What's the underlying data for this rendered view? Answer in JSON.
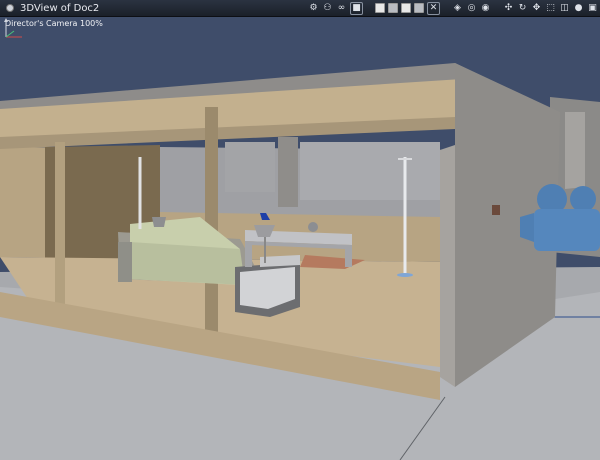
{
  "window": {
    "title": "3DView of Doc2"
  },
  "viewport": {
    "camera_label": "Director's Camera 100%"
  },
  "toolbar": {
    "icons": [
      "render-options-icon",
      "hierarchy-icon",
      "glasses-icon",
      "shading-solid-icon",
      "layout-1-icon",
      "layout-2-icon",
      "layout-3-icon",
      "layout-4-icon",
      "close-x-icon",
      "camera-dolly-icon",
      "camera-orbit-icon",
      "camera-pan-icon",
      "camera-rotate-icon",
      "camera-move-icon",
      "camera-zoom-icon",
      "bounding-box-icon",
      "cube-icon",
      "sphere-icon",
      "render-area-icon"
    ]
  },
  "colors": {
    "background": "#3f4d6a",
    "floor": "#b0b2b6",
    "wall_inner": "#c0ad8d",
    "wall_outer": "#95918c",
    "camera_object": "#4f7fb3"
  }
}
